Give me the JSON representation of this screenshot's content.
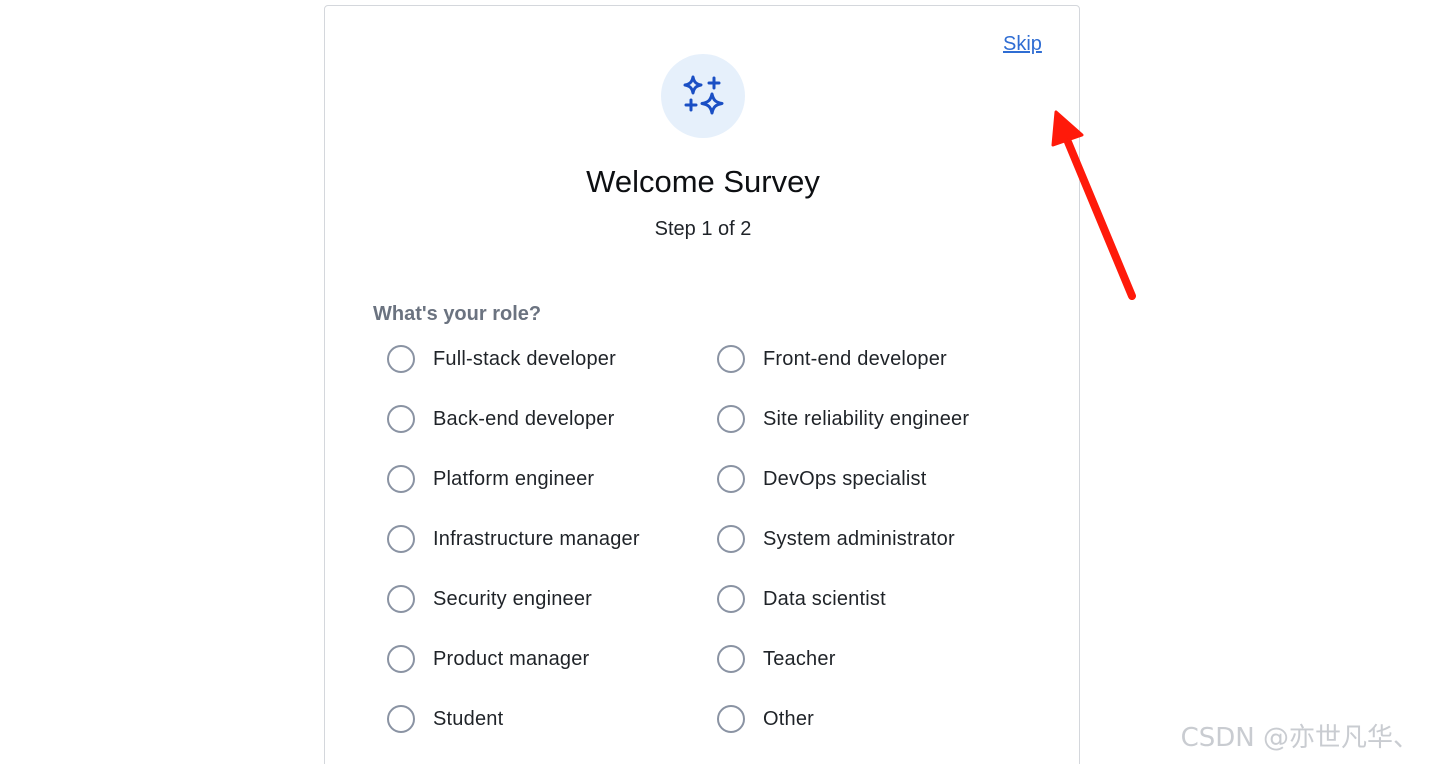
{
  "survey": {
    "skip_label": "Skip",
    "title": "Welcome Survey",
    "step": "Step 1 of 2",
    "question": "What's your role?",
    "options": [
      "Full-stack developer",
      "Front-end developer",
      "Back-end developer",
      "Site reliability engineer",
      "Platform engineer",
      "DevOps specialist",
      "Infrastructure manager",
      "System administrator",
      "Security engineer",
      "Data scientist",
      "Product manager",
      "Teacher",
      "Student",
      "Other"
    ],
    "hero_icon": "sparkles-icon"
  },
  "annotation": {
    "arrow_color": "#ff1a0a",
    "arrow_icon": "arrow-annotation-icon"
  },
  "watermark": {
    "text": "CSDN @亦世凡华、"
  },
  "colors": {
    "link": "#2f6dd3",
    "icon": "#1a4fc4",
    "icon_bg": "#e6f0fb",
    "radio_border": "#8a93a3",
    "question_text": "#6b7380"
  }
}
